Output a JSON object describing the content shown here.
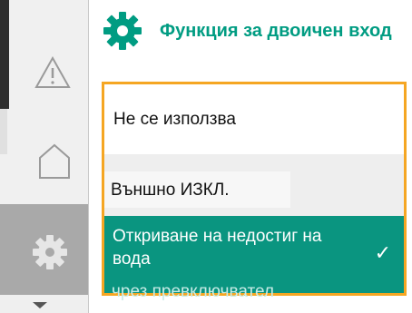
{
  "header": {
    "title": "Функция за двоичен вход",
    "icon": "gear-icon",
    "accent_color": "#009c82"
  },
  "rail": {
    "items": [
      {
        "icon": "warning-icon"
      },
      {
        "icon": "home-icon"
      },
      {
        "icon": "settings-gear-icon",
        "active": true
      }
    ],
    "scroll_icon": "chevron-down-icon"
  },
  "options": [
    {
      "label": "Не се използва"
    },
    {
      "label": "Външно ИЗКЛ."
    },
    {
      "label": "Откриване на недостиг на вода",
      "continuation": "чрез превключвател",
      "selected": true,
      "check": "✓"
    }
  ],
  "colors": {
    "selected_bg": "#0a9580",
    "focus_border": "#f5a623"
  }
}
